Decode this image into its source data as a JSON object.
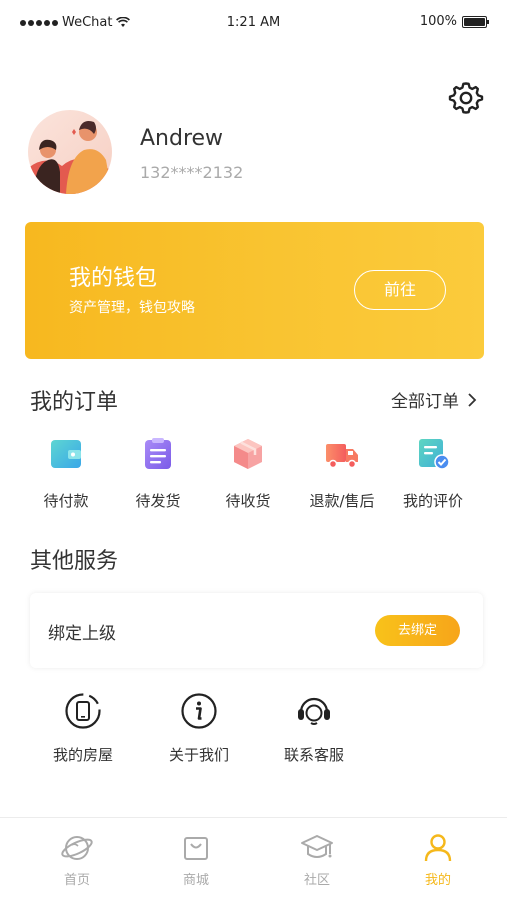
{
  "status_bar": {
    "carrier": "WeChat",
    "time": "1:21 AM",
    "battery": "100%"
  },
  "profile": {
    "name": "Andrew",
    "phone": "132****2132"
  },
  "wallet": {
    "title": "我的钱包",
    "subtitle": "资产管理，钱包攻略",
    "button": "前往"
  },
  "orders": {
    "title": "我的订单",
    "all_label": "全部订单",
    "items": [
      {
        "label": "待付款",
        "icon": "wallet-icon"
      },
      {
        "label": "待发货",
        "icon": "clipboard-icon"
      },
      {
        "label": "待收货",
        "icon": "package-icon"
      },
      {
        "label": "退款/售后",
        "icon": "truck-icon"
      },
      {
        "label": "我的评价",
        "icon": "review-icon"
      }
    ]
  },
  "services": {
    "title": "其他服务",
    "bind_label": "绑定上级",
    "bind_button": "去绑定",
    "items": [
      {
        "label": "我的房屋",
        "icon": "house-device-icon"
      },
      {
        "label": "关于我们",
        "icon": "info-icon"
      },
      {
        "label": "联系客服",
        "icon": "headset-icon"
      }
    ]
  },
  "tabbar": {
    "items": [
      {
        "label": "首页",
        "icon": "planet-icon"
      },
      {
        "label": "商城",
        "icon": "shop-icon"
      },
      {
        "label": "社区",
        "icon": "graduation-cap-icon"
      },
      {
        "label": "我的",
        "icon": "user-icon"
      }
    ],
    "active_index": 3
  },
  "colors": {
    "accent": "#F5B81B",
    "wallet_gradient": [
      "#F7B81F",
      "#FBCB3C"
    ],
    "text": "#333333",
    "muted": "#AAAAAA"
  }
}
